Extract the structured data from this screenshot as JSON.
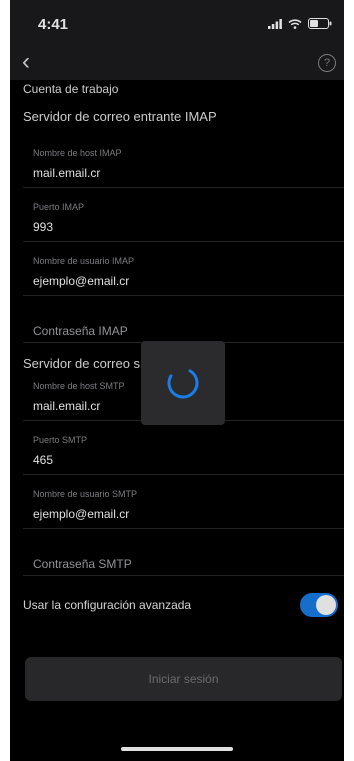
{
  "status": {
    "time": "4:41"
  },
  "nav": {
    "help_icon": "?"
  },
  "top_row": "Cuenta de trabajo",
  "imap": {
    "header": "Servidor de correo entrante IMAP",
    "host_label": "Nombre de host IMAP",
    "host_value": "mail.email.cr",
    "port_label": "Puerto IMAP",
    "port_value": "993",
    "user_label": "Nombre de usuario IMAP",
    "user_value": "ejemplo@email.cr",
    "password_label": "Contraseña IMAP"
  },
  "smtp": {
    "header": "Servidor de correo s",
    "host_label": "Nombre de host SMTP",
    "host_value": "mail.email.cr",
    "port_label": "Puerto SMTP",
    "port_value": "465",
    "user_label": "Nombre de usuario SMTP",
    "user_value": "ejemplo@email.cr",
    "password_label": "Contraseña SMTP"
  },
  "advanced": {
    "label": "Usar la configuración avanzada",
    "enabled": true
  },
  "signin_label": "Iniciar sesión",
  "colors": {
    "accent": "#1a7ee8",
    "background": "#000000",
    "header_bg": "#1c1c1e"
  }
}
